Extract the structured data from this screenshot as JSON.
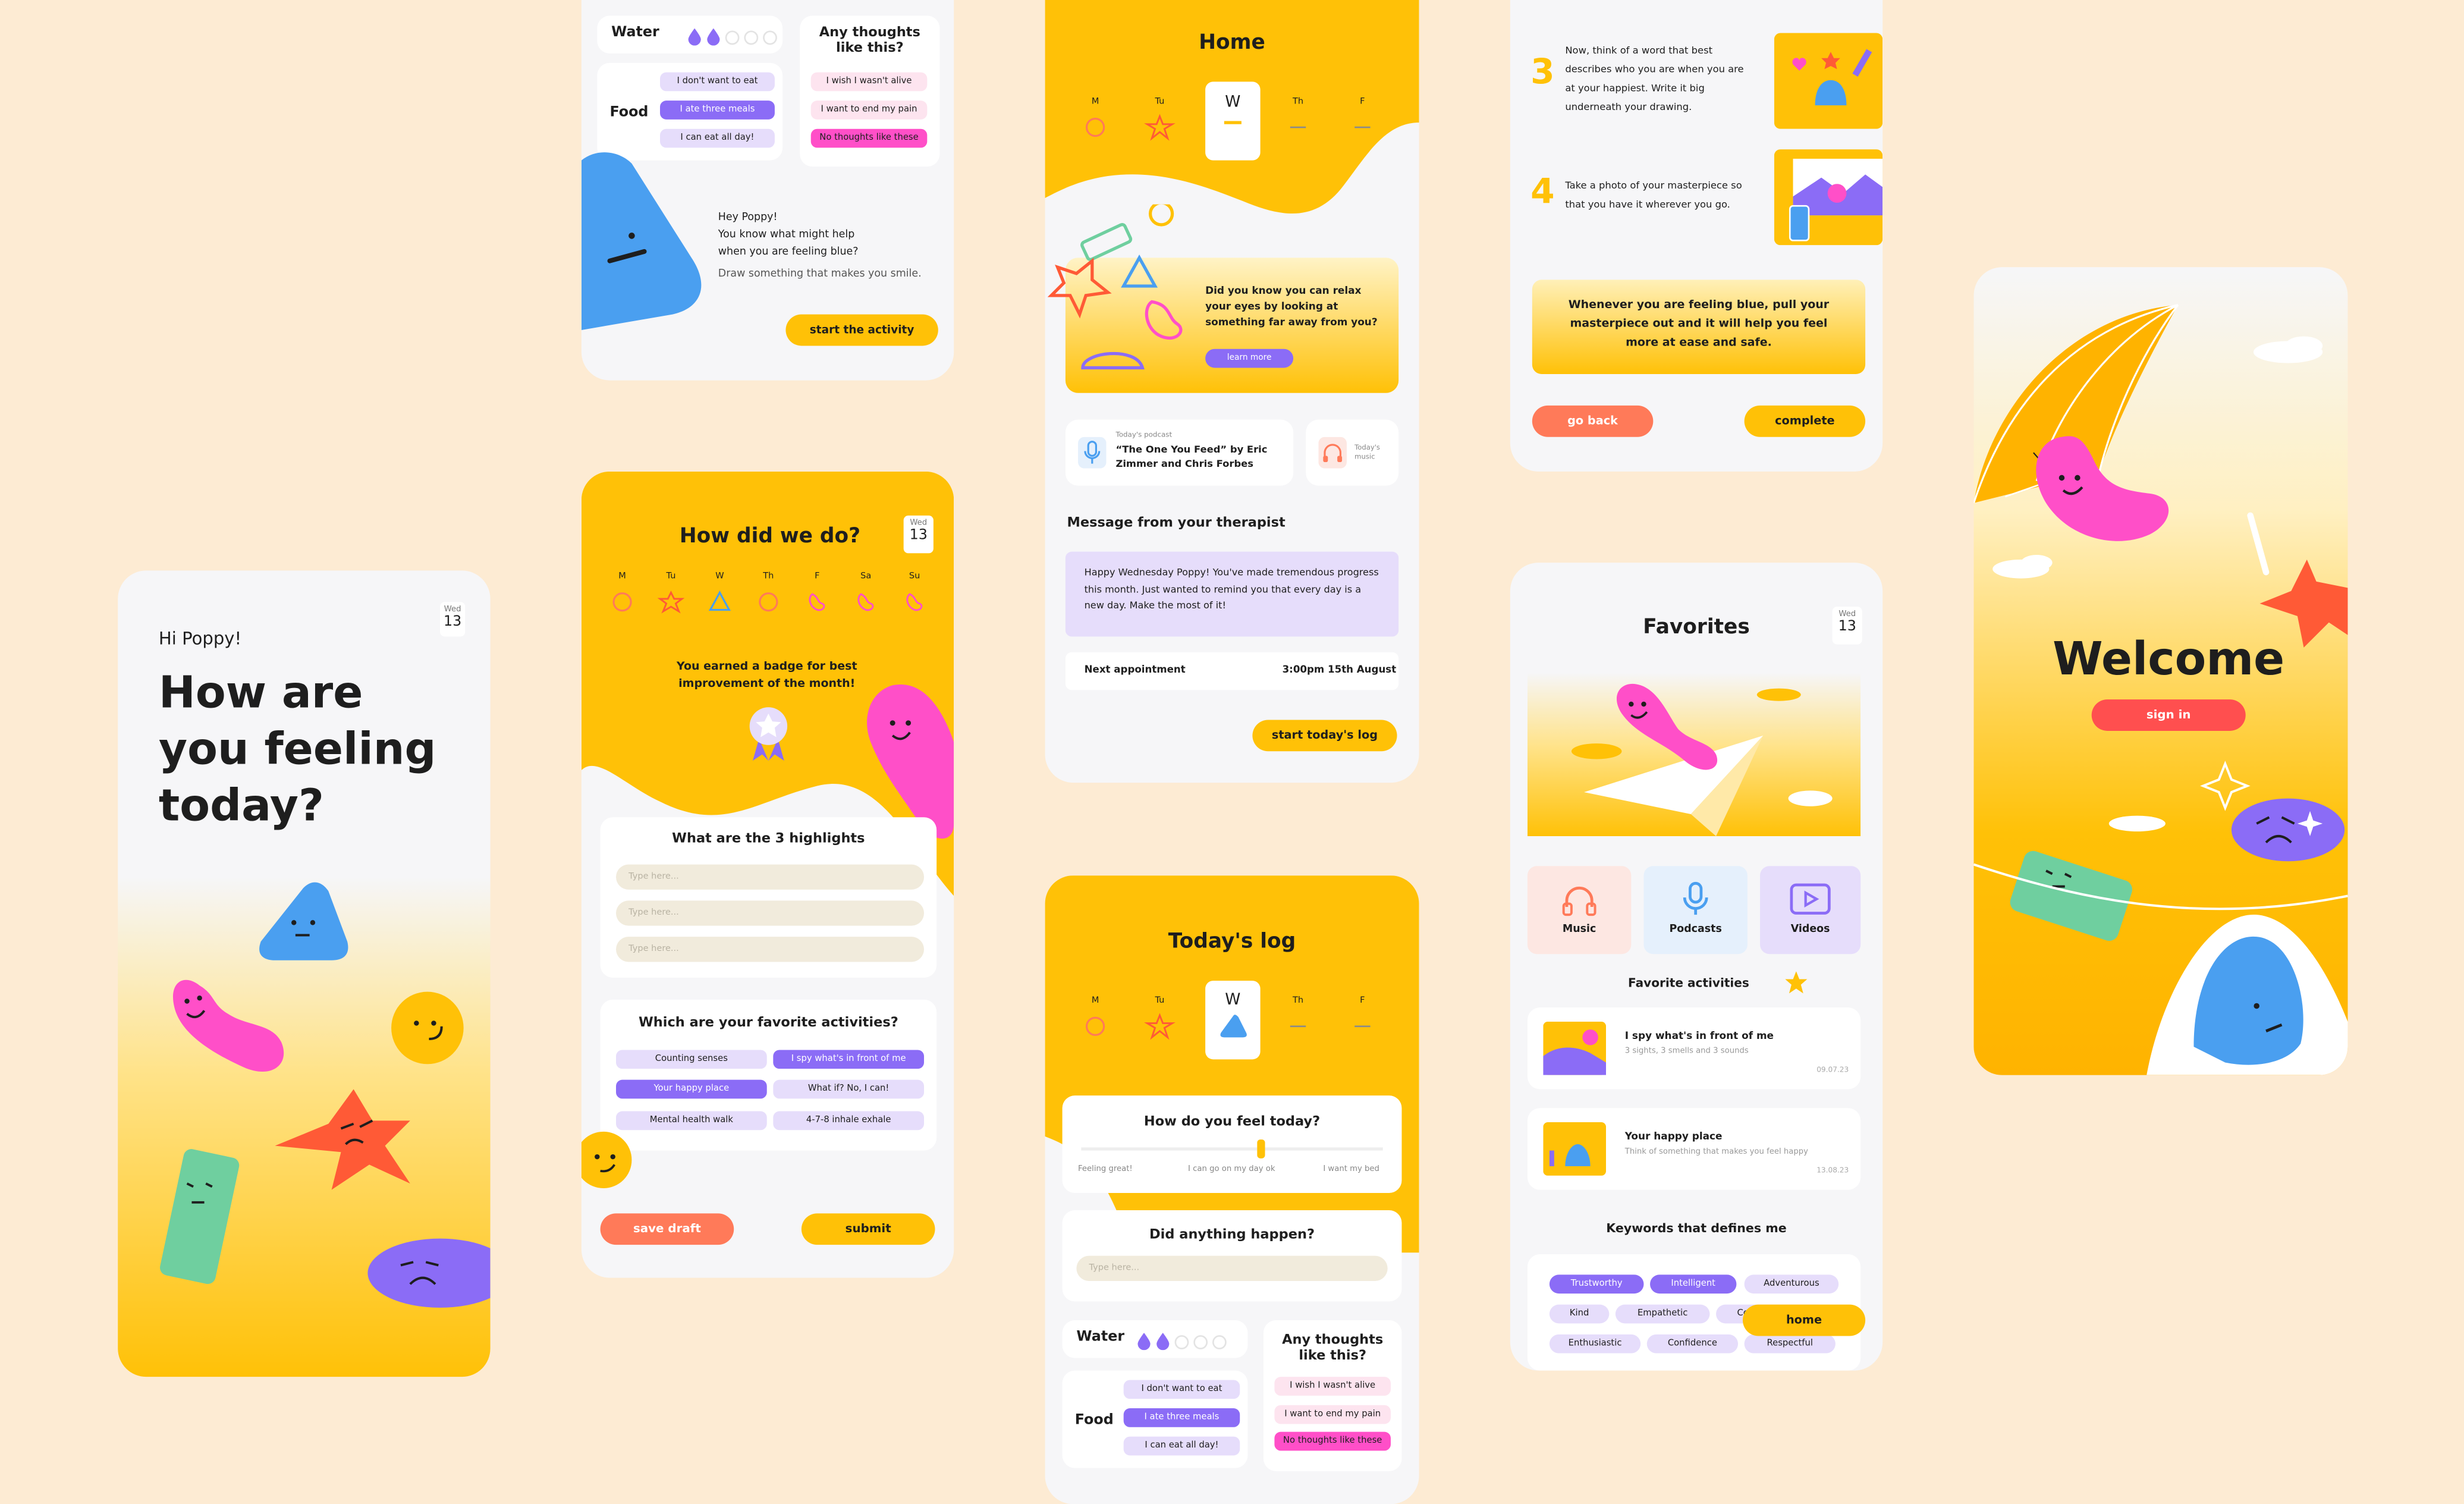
{
  "common": {
    "day_label": "Wed",
    "day_number": "13",
    "weekdays_short": [
      "M",
      "Tu",
      "W",
      "Th",
      "F"
    ],
    "weekdays_full": [
      "M",
      "Tu",
      "W",
      "Th",
      "F",
      "Sa",
      "Su"
    ]
  },
  "feeling": {
    "greeting": "Hi Poppy!",
    "heading": "How are you feeling today?"
  },
  "activity": {
    "water_label": "Water",
    "food_label": "Food",
    "thoughts_title": "Any thoughts like this?",
    "food_options": [
      "I don't want to eat",
      "I ate three meals",
      "I can eat all day!"
    ],
    "thought_options": [
      "I wish I wasn't alive",
      "I want to end my pain",
      "No thoughts like these"
    ],
    "line1": "Hey Poppy!",
    "line2": "You know what might help",
    "line3": "when you are feeling blue?",
    "line4": "Draw something that makes you smile.",
    "start_button": "start the activity"
  },
  "review": {
    "title": "How did we do?",
    "badge_text": "You earned a badge for best improvement of the month!",
    "highlights_title": "What are the 3 highlights",
    "placeholder": "Type here...",
    "favorites_title": "Which are your favorite activities?",
    "activities": [
      "Counting senses",
      "I spy what's in front of me",
      "Your happy place",
      "What if? No, I can!",
      "Mental health walk",
      "4-7-8 inhale exhale"
    ],
    "save_button": "save draft",
    "submit_button": "submit"
  },
  "home": {
    "title": "Home",
    "selected_day": "W",
    "tip_text": "Did you know you can relax your eyes by looking at something far away from you?",
    "learn_more": "learn more",
    "podcast_caption": "Today's podcast",
    "podcast_title": "“The One You Feed” by Eric Zimmer and Chris Forbes",
    "music_caption": "Today's music",
    "message_title": "Message from your therapist",
    "message_body": "Happy Wednesday Poppy! You've made tremendous progress this month. Just wanted to remind you that every day is a new day. Make the most of it!",
    "appointment_label": "Next appointment",
    "appointment_time": "3:00pm 15th August",
    "start_log": "start today's log"
  },
  "log": {
    "title": "Today's log",
    "selected_day": "W",
    "feel_title": "How do you feel today?",
    "scale_labels": [
      "Feeling great!",
      "I can go on my day ok",
      "I want my bed"
    ],
    "slider_value": 0.5,
    "happen_title": "Did anything happen?",
    "placeholder": "Type here...",
    "water_label": "Water",
    "food_label": "Food",
    "thoughts_title": "Any thoughts like this?",
    "food_options": [
      "I don't want to eat",
      "I ate three meals",
      "I can eat all day!"
    ],
    "thought_options": [
      "I wish I wasn't alive",
      "I want to end my pain",
      "No thoughts like these"
    ]
  },
  "steps": {
    "step3_number": "3",
    "step3_text": "Now, think of a word that best describes who you are when you are at your happiest. Write it big underneath your drawing.",
    "step4_number": "4",
    "step4_text": "Take a photo of your masterpiece so that you have it wherever you go.",
    "note": "Whenever you are feeling blue, pull your masterpiece out and it will help you feel more at ease and safe.",
    "back_button": "go back",
    "complete_button": "complete"
  },
  "favorites": {
    "title": "Favorites",
    "categories": [
      "Music",
      "Podcasts",
      "Videos"
    ],
    "activities_title": "Favorite activities",
    "item1_title": "I spy what's in front of me",
    "item1_sub": "3 sights, 3 smells and 3 sounds",
    "item1_date": "09.07.23",
    "item2_title": "Your happy place",
    "item2_sub": "Think of something that makes you feel happy",
    "item2_date": "13.08.23",
    "keywords_title": "Keywords that defines me",
    "keywords": [
      "Trustworthy",
      "Intelligent",
      "Adventurous",
      "Kind",
      "Empathetic",
      "Compassionate",
      "Enthusiastic",
      "Confidence",
      "Respectful"
    ],
    "home_button": "home"
  },
  "welcome": {
    "title": "Welcome",
    "sign_in": "sign in"
  },
  "colors": {
    "yellow": "#FFC107",
    "purple": "#8B6CF6",
    "lavender": "#E6DDFB",
    "pink": "#FF4FC8",
    "orange": "#FF7A59",
    "blue": "#4A9FF0",
    "green": "#6FCF9F"
  }
}
